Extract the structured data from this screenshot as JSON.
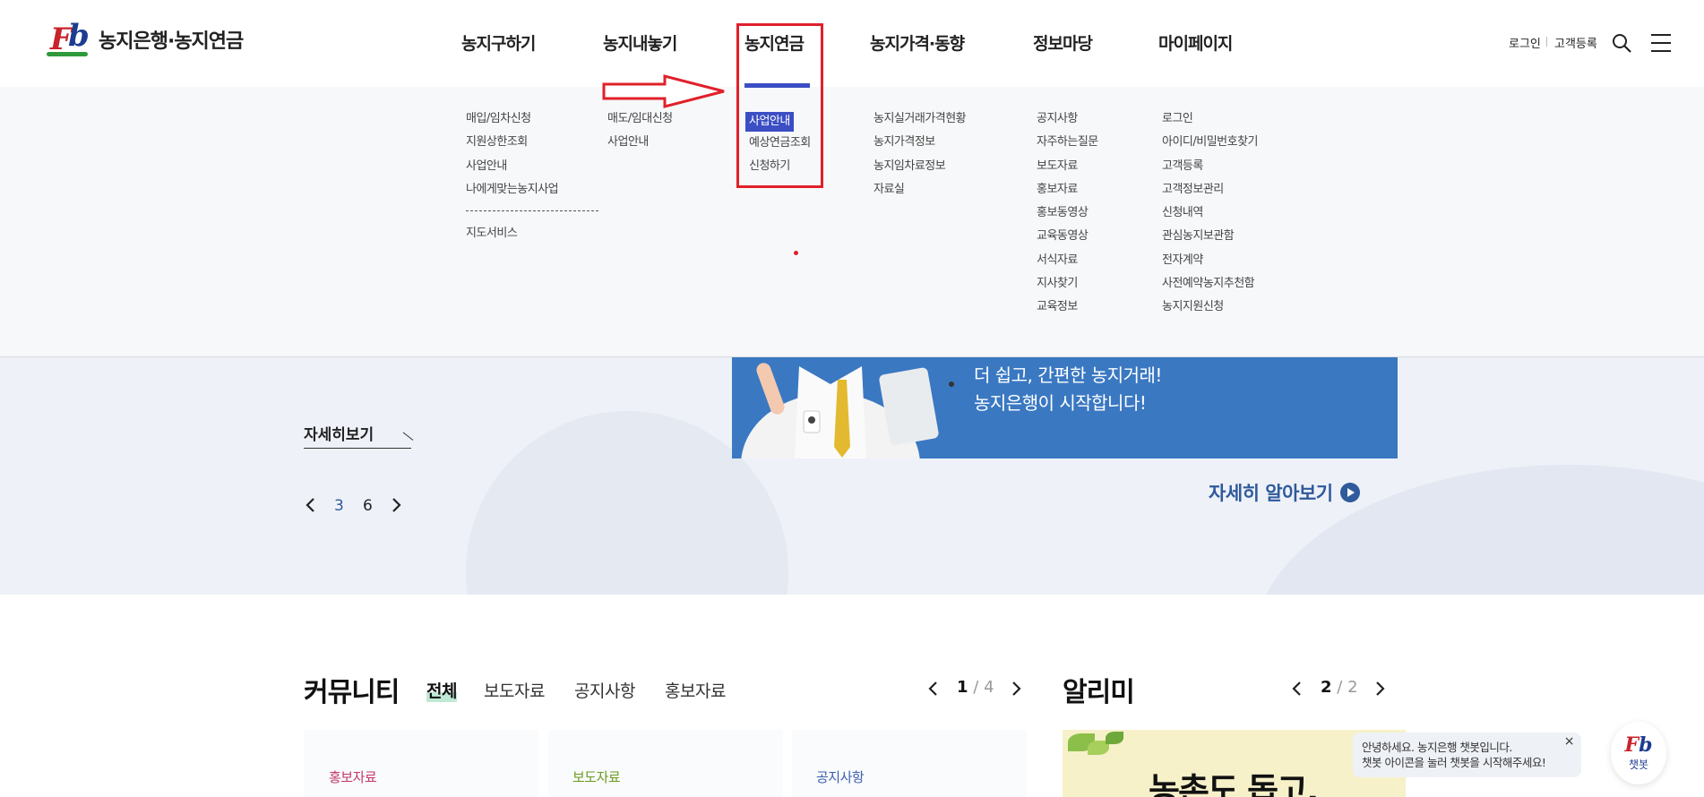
{
  "logo": {
    "text": "농지은행·농지연금"
  },
  "gnb": [
    {
      "label": "농지구하기"
    },
    {
      "label": "농지내놓기"
    },
    {
      "label": "농지연금"
    },
    {
      "label": "농지가격·동향"
    },
    {
      "label": "정보마당"
    },
    {
      "label": "마이페이지"
    }
  ],
  "util": {
    "login": "로그인",
    "register": "고객등록"
  },
  "icons": {
    "search": "search-icon",
    "menu": "hamburger-menu-icon"
  },
  "mega": {
    "col1": [
      "매입/임차신청",
      "지원상한조회",
      "사업안내",
      "나에게맞는농지사업"
    ],
    "col1_extra": [
      "지도서비스"
    ],
    "col2": [
      "매도/임대신청",
      "사업안내"
    ],
    "col3": [
      "사업안내",
      "예상연금조회",
      "신청하기"
    ],
    "col4": [
      "농지실거래가격현황",
      "농지가격정보",
      "농지임차료정보",
      "자료실"
    ],
    "col5": [
      "공지사항",
      "자주하는질문",
      "보도자료",
      "홍보자료",
      "홍보동영상",
      "교육동영상",
      "서식자료",
      "지사찾기",
      "교육정보"
    ],
    "col6": [
      "로그인",
      "아이디/비밀번호찾기",
      "고객등록",
      "고객정보관리",
      "신청내역",
      "관심농지보관함",
      "전자계약",
      "사전예약농지추천함",
      "농지지원신청"
    ]
  },
  "hero": {
    "detail_link": "자세히보기",
    "pager": {
      "current": "3",
      "total": "6"
    },
    "banner_line1": "더 쉽고, 간편한 농지거래!",
    "banner_line2": "농지은행이 시작합니다!",
    "banner_more": "자세히 알아보기"
  },
  "community": {
    "title": "커뮤니티",
    "tabs": [
      "전체",
      "보도자료",
      "공지사항",
      "홍보자료"
    ],
    "page_current": "1",
    "page_sep": "/",
    "page_total": "4",
    "cards": [
      {
        "category": "홍보자료",
        "color": "#c2386a"
      },
      {
        "category": "보도자료",
        "color": "#6a9a1f"
      },
      {
        "category": "공지사항",
        "color": "#3b5fb0"
      }
    ]
  },
  "alimi": {
    "title": "알리미",
    "page_current": "2",
    "page_sep": "/",
    "page_total": "2",
    "banner_text": "농촌도 돕고,"
  },
  "chat": {
    "line1": "안녕하세요. 농지은행 챗봇입니다.",
    "line2": "챗봇 아이콘을 눌러 챗봇을 시작해주세요!",
    "close": "×",
    "bot_label": "챗봇"
  },
  "colors": {
    "accent": "#3b4ec4",
    "annotation": "#e0202a",
    "banner": "#3a78c2"
  }
}
